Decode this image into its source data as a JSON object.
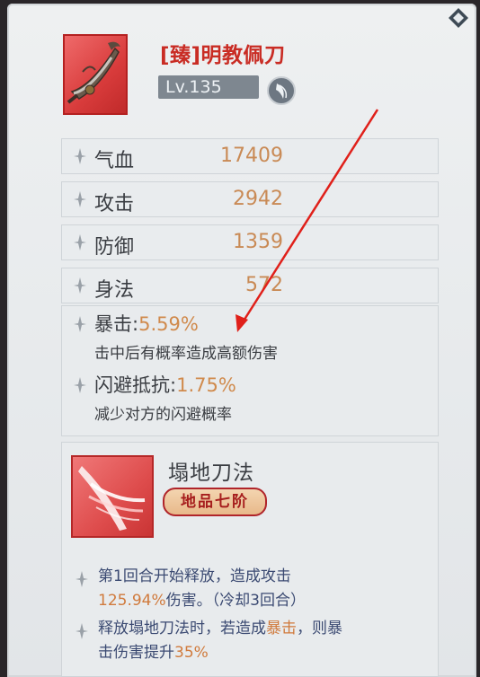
{
  "item": {
    "name": "[臻]明教佩刀",
    "level": "Lv.135",
    "icon": "sword-icon",
    "badge_icon": "weapon-type-badge-icon"
  },
  "stats": [
    {
      "label": "气血",
      "value": "17409"
    },
    {
      "label": "攻击",
      "value": "2942"
    },
    {
      "label": "防御",
      "value": "1359"
    },
    {
      "label": "身法",
      "value": "572"
    }
  ],
  "attributes": [
    {
      "name": "暴击:",
      "value": "5.59%",
      "desc": "击中后有概率造成高额伤害"
    },
    {
      "name": "闪避抵抗:",
      "value": "1.75%",
      "desc": "减少对方的闪避概率"
    }
  ],
  "skill": {
    "name": "塌地刀法",
    "grade": "地品七阶",
    "desc1_a": "第1回合开始释放，造成攻击",
    "desc1_b_hl": "125.94%",
    "desc1_b": "伤害。（冷却3回合）",
    "desc2_a": "释放塌地刀法时，若造成",
    "desc2_hl": "暴击",
    "desc2_b": "，则暴",
    "desc2_c": "击伤害提升",
    "desc2_c_hl": "35%"
  },
  "colors": {
    "item_name": "#c92c24",
    "stat_value": "#c98a55",
    "highlight": "#d07a3c",
    "annotation_arrow": "#e0201a"
  }
}
